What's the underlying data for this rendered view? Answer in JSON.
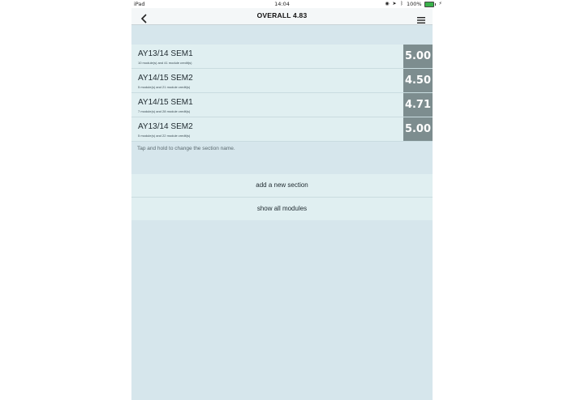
{
  "status_bar": {
    "device": "iPad",
    "time": "14:04",
    "battery": "100%",
    "battery_level": 1.0
  },
  "nav": {
    "title": "OVERALL 4.83",
    "icons": {
      "back": "chevron-left-icon",
      "menu": "hamburger-menu-icon"
    }
  },
  "sections": [
    {
      "name": "AY13/14 SEM1",
      "detail": "10 module(s) and 41 module credit(s)",
      "score": "5.00"
    },
    {
      "name": "AY14/15 SEM2",
      "detail": "5 module(s) and 21 module credit(s)",
      "score": "4.50"
    },
    {
      "name": "AY14/15 SEM1",
      "detail": "7 module(s) and 28 module credit(s)",
      "score": "4.71"
    },
    {
      "name": "AY13/14 SEM2",
      "detail": "5 module(s) and 22 module credit(s)",
      "score": "5.00"
    }
  ],
  "hint": "Tap and hold to change the section name.",
  "actions": {
    "add_section": "add a new section",
    "show_modules": "show all modules"
  },
  "colors": {
    "background": "#d6e6ec",
    "row": "#e0eff1",
    "score_tile": "#7d8d8f",
    "battery": "#39b24a"
  }
}
